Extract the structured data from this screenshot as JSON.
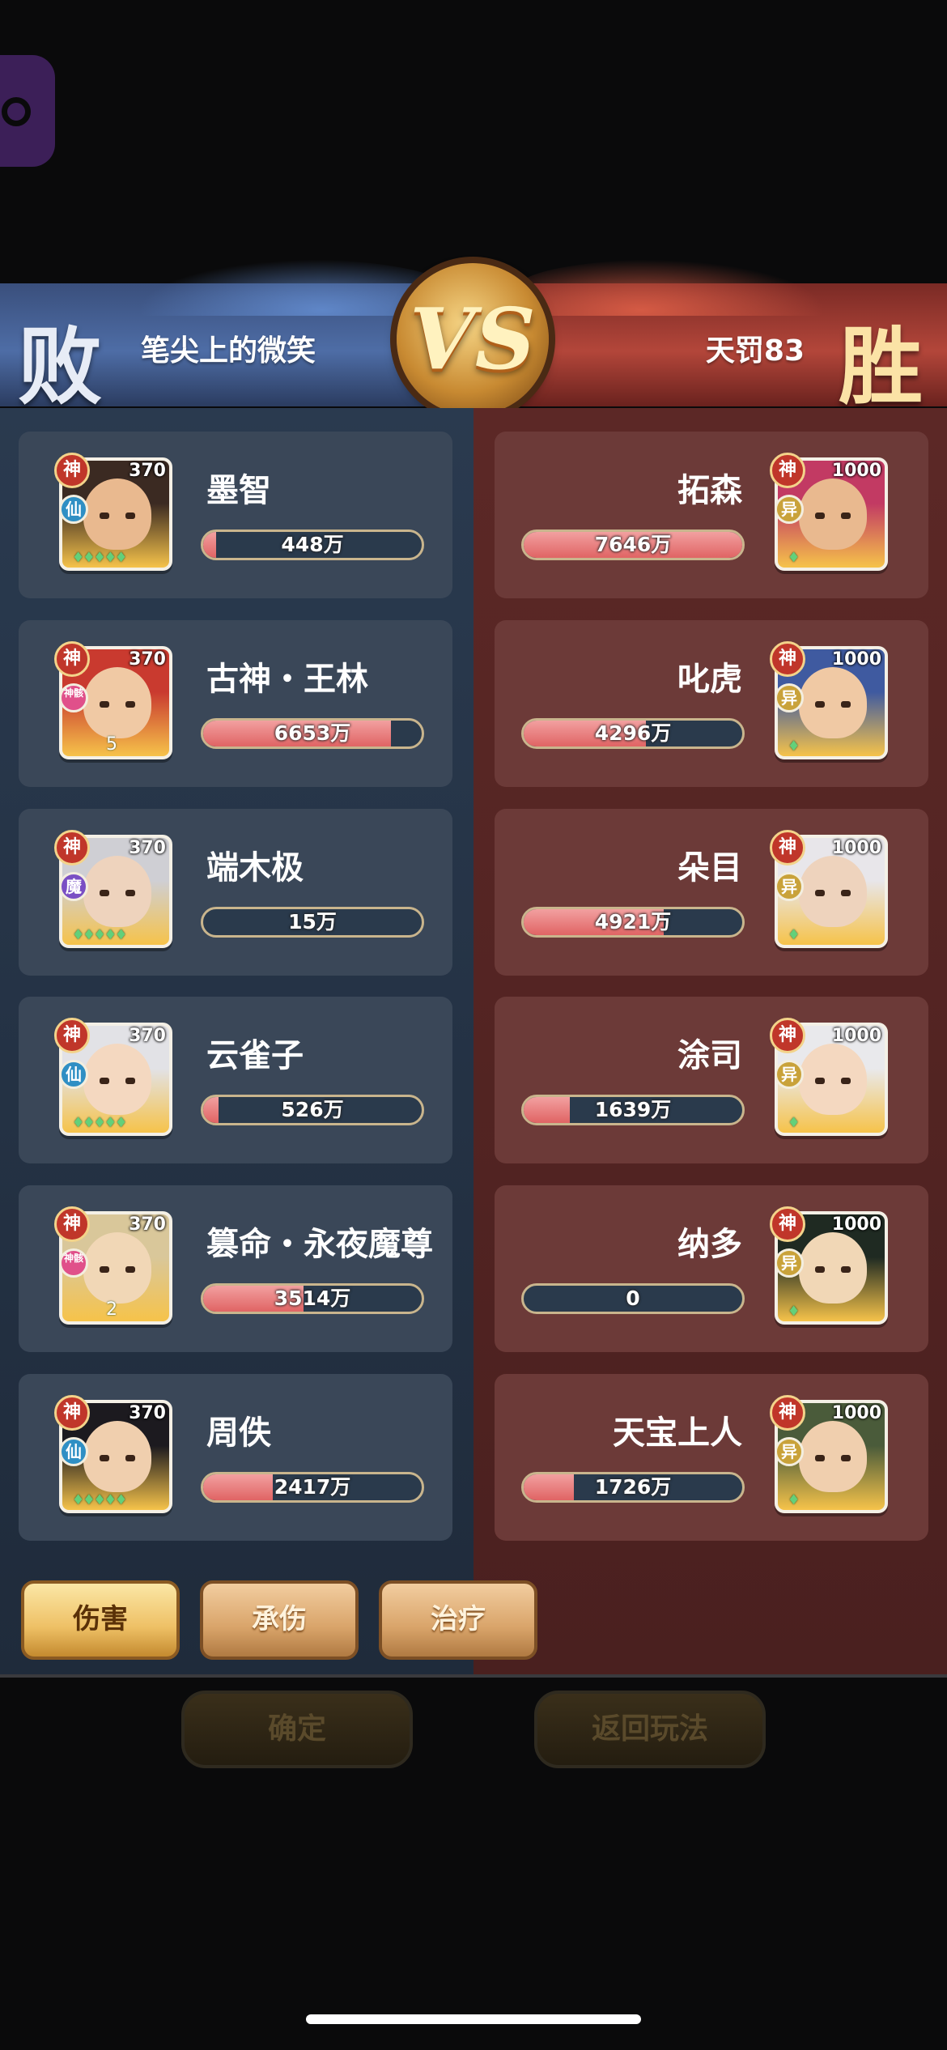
{
  "header": {
    "left_result": "败",
    "left_player": "笔尖上的微笑",
    "right_result": "胜",
    "right_player": "天罚83",
    "vs": "VS"
  },
  "left_team": [
    {
      "badge": "神",
      "faction": "仙",
      "faction_color": "#2f8fc4",
      "level": "370",
      "name": "墨智",
      "value": "448万",
      "ratio": 0.06,
      "stars": "♦♦♦♦♦"
    },
    {
      "badge": "神",
      "faction": "神骸",
      "faction_color": "#e0508a",
      "level": "370",
      "name": "古神・王林",
      "value": "6653万",
      "ratio": 0.86,
      "stars": "5"
    },
    {
      "badge": "神",
      "faction": "魔",
      "faction_color": "#7a4fc4",
      "level": "370",
      "name": "端木极",
      "value": "15万",
      "ratio": 0.0,
      "stars": "♦♦♦♦♦"
    },
    {
      "badge": "神",
      "faction": "仙",
      "faction_color": "#2f8fc4",
      "level": "370",
      "name": "云雀子",
      "value": "526万",
      "ratio": 0.07,
      "stars": "♦♦♦♦♦"
    },
    {
      "badge": "神",
      "faction": "神骸",
      "faction_color": "#e0508a",
      "level": "370",
      "name": "篡命・永夜魔尊",
      "value": "3514万",
      "ratio": 0.46,
      "stars": "2"
    },
    {
      "badge": "神",
      "faction": "仙",
      "faction_color": "#2f8fc4",
      "level": "370",
      "name": "周佚",
      "value": "2417万",
      "ratio": 0.32,
      "stars": "♦♦♦♦♦"
    }
  ],
  "right_team": [
    {
      "badge": "神",
      "faction": "异",
      "faction_color": "#c9a23a",
      "level": "1000",
      "name": "拓森",
      "value": "7646万",
      "ratio": 1.0,
      "stars": "♦"
    },
    {
      "badge": "神",
      "faction": "异",
      "faction_color": "#c9a23a",
      "level": "1000",
      "name": "叱虎",
      "value": "4296万",
      "ratio": 0.56,
      "stars": "♦"
    },
    {
      "badge": "神",
      "faction": "异",
      "faction_color": "#c9a23a",
      "level": "1000",
      "name": "朵目",
      "value": "4921万",
      "ratio": 0.64,
      "stars": "♦"
    },
    {
      "badge": "神",
      "faction": "异",
      "faction_color": "#c9a23a",
      "level": "1000",
      "name": "涂司",
      "value": "1639万",
      "ratio": 0.21,
      "stars": "♦"
    },
    {
      "badge": "神",
      "faction": "异",
      "faction_color": "#c9a23a",
      "level": "1000",
      "name": "纳多",
      "value": "0",
      "ratio": 0.0,
      "stars": "♦"
    },
    {
      "badge": "神",
      "faction": "异",
      "faction_color": "#c9a23a",
      "level": "1000",
      "name": "天宝上人",
      "value": "1726万",
      "ratio": 0.23,
      "stars": "♦"
    }
  ],
  "tabs": [
    {
      "label": "伤害",
      "active": true
    },
    {
      "label": "承伤",
      "active": false
    },
    {
      "label": "治疗",
      "active": false
    }
  ],
  "bottom_buttons": {
    "confirm": "确定",
    "back": "返回玩法"
  },
  "colors": {
    "left_panel": "#2a3a4f",
    "right_panel": "#5c2826",
    "bar_fill": "#e06464"
  }
}
